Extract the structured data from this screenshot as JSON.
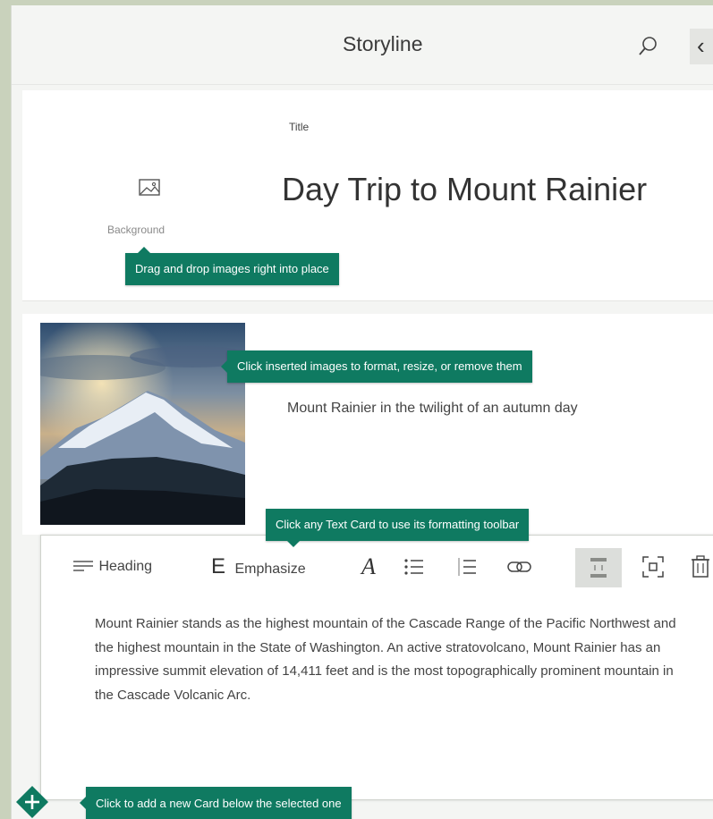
{
  "header": {
    "title": "Storyline"
  },
  "title_card": {
    "background_label": "Background",
    "title_label": "Title",
    "title": "Day Trip to Mount Rainier"
  },
  "tips": {
    "drag_drop": "Drag and drop images right into place",
    "click_images": "Click inserted images to format, resize, or remove them",
    "text_card": "Click any Text Card to use its formatting toolbar",
    "add_card": "Click to add a new Card below the selected one"
  },
  "image_card": {
    "caption": "Mount Rainier in the twilight of an autumn day"
  },
  "toolbar": {
    "heading_label": "Heading",
    "emphasize_label": "Emphasize"
  },
  "text_card": {
    "body": "Mount Rainier stands as the highest mountain of the Cascade Range of the Pacific Northwest and the highest mountain in the State of Washington. An active stratovolcano, Mount Rainier has an impressive summit elevation of 14,411 feet and is the most topographically prominent mountain in the Cascade Volcanic Arc."
  },
  "colors": {
    "accent": "#0f7a61",
    "background": "#c9d2bc"
  },
  "icons": [
    "search-icon",
    "chevron-left-icon",
    "image-icon",
    "heading-icon",
    "emphasize-icon",
    "font-icon",
    "bullet-list-icon",
    "numbered-list-icon",
    "link-icon",
    "layout-icon",
    "focus-icon",
    "delete-icon",
    "add-icon"
  ]
}
